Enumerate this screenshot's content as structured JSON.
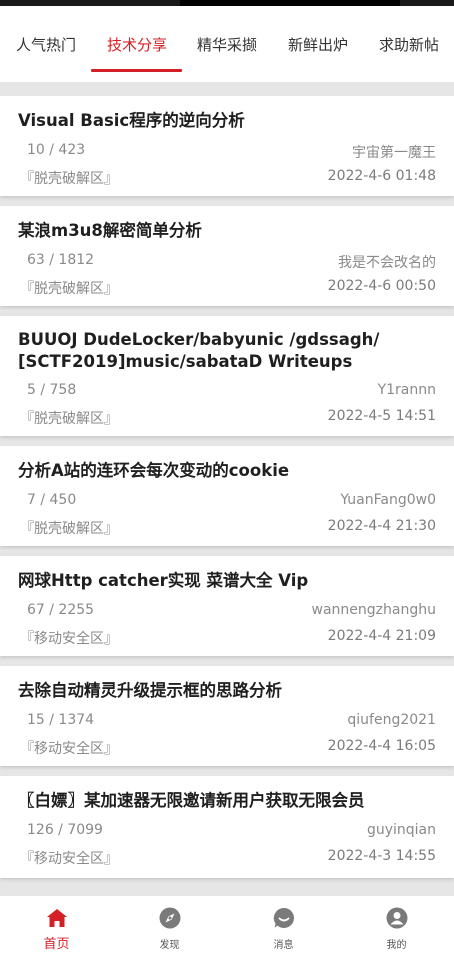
{
  "tabs": [
    {
      "label": "人气热门"
    },
    {
      "label": "技术分享"
    },
    {
      "label": "精华采撷"
    },
    {
      "label": "新鲜出炉"
    },
    {
      "label": "求助新帖"
    }
  ],
  "posts": [
    {
      "title": "Visual Basic程序的逆向分析",
      "stats": "10 / 423",
      "author": "宇宙第一魔王",
      "forum": "『脱壳破解区』",
      "date": "2022-4-6 01:48"
    },
    {
      "title": "某浪m3u8解密简单分析",
      "stats": "63 / 1812",
      "author": "我是不会改名的",
      "forum": "『脱壳破解区』",
      "date": "2022-4-6 00:50"
    },
    {
      "title": "BUUOJ DudeLocker/babyunic /gdssagh/",
      "title_line2": "[SCTF2019]music/sabataD Writeups",
      "stats": "5 / 758",
      "author": "Y1rannn",
      "forum": "『脱壳破解区』",
      "date": "2022-4-5 14:51"
    },
    {
      "title": "分析A站的连环会每次变动的cookie",
      "stats": "7 / 450",
      "author": "YuanFang0w0",
      "forum": "『脱壳破解区』",
      "date": "2022-4-4 21:30"
    },
    {
      "title": "网球Http catcher实现 菜谱大全 Vip",
      "stats": "67 / 2255",
      "author": "wannengzhanghu",
      "forum": "『移动安全区』",
      "date": "2022-4-4 21:09"
    },
    {
      "title": "去除自动精灵升级提示框的思路分析",
      "stats": "15 / 1374",
      "author": "qiufeng2021",
      "forum": "『移动安全区』",
      "date": "2022-4-4 16:05"
    },
    {
      "title": "〖白嫖〗某加速器无限邀请新用户获取无限会员",
      "stats": "126 / 7099",
      "author": "guyinqian",
      "forum": "『移动安全区』",
      "date": "2022-4-3 14:55"
    }
  ],
  "bottom_nav": [
    {
      "label": "首页",
      "icon": "home-icon"
    },
    {
      "label": "发现",
      "icon": "compass-icon"
    },
    {
      "label": "消息",
      "icon": "chat-icon"
    },
    {
      "label": "我的",
      "icon": "user-icon"
    }
  ],
  "colors": {
    "accent": "#d51f26",
    "icon_gray": "#7a7a7a"
  }
}
